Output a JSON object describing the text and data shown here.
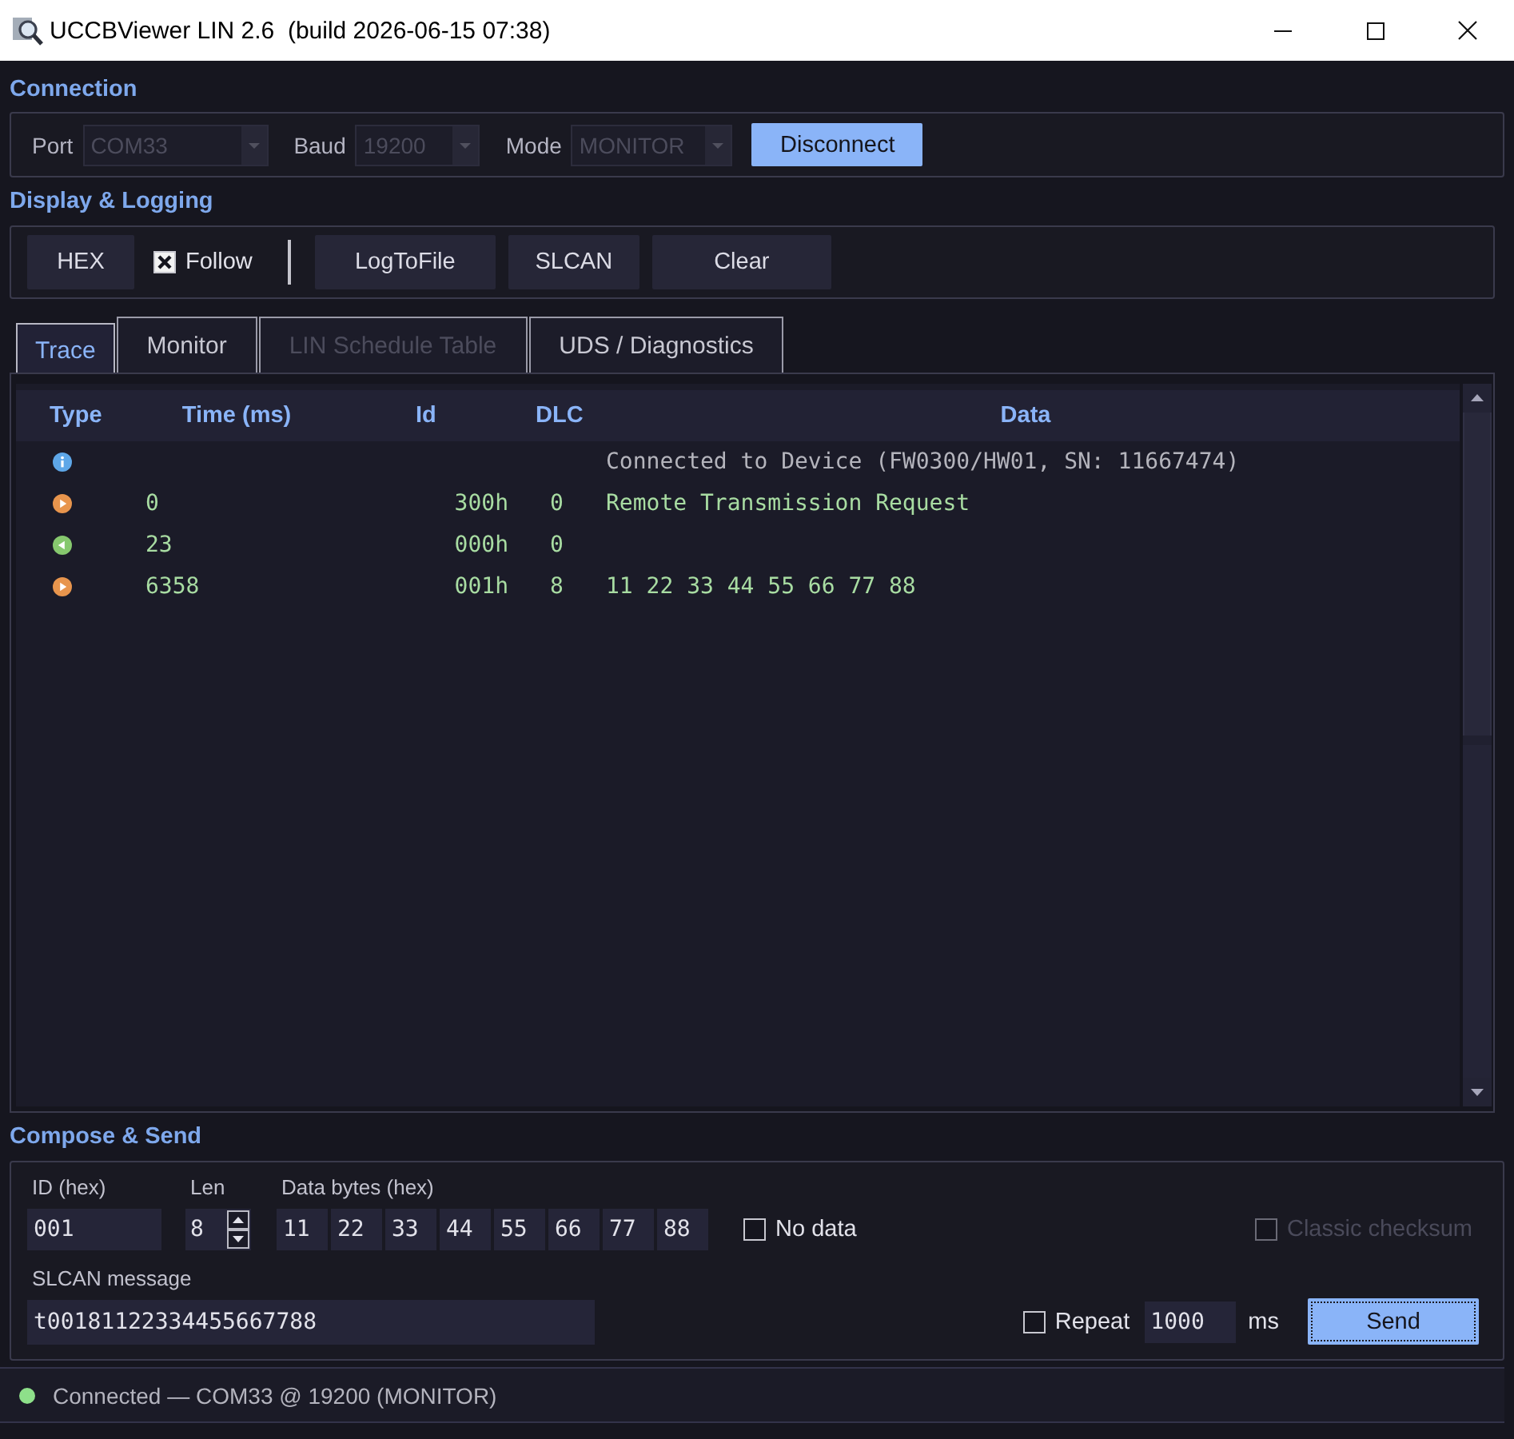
{
  "window": {
    "title": "UCCBViewer LIN 2.6  (build 2026-06-15 07:38)"
  },
  "connection": {
    "title": "Connection",
    "fields": [
      {
        "label": "Port",
        "value": "COM33",
        "disabled": true
      },
      {
        "label": "Baud",
        "value": "19200",
        "disabled": true
      },
      {
        "label": "Mode",
        "value": "MONITOR",
        "disabled": true
      }
    ],
    "button": {
      "label": "Disconnect",
      "primary": true
    }
  },
  "display": {
    "title": "Display & Logging",
    "items": [
      {
        "kind": "button",
        "label": "HEX"
      },
      {
        "kind": "checkbox",
        "label": "Follow",
        "checked": true
      },
      {
        "kind": "separator"
      },
      {
        "kind": "button",
        "label": "LogToFile"
      },
      {
        "kind": "button",
        "label": "SLCAN"
      },
      {
        "kind": "button",
        "label": "Clear"
      }
    ]
  },
  "tabs": [
    {
      "label": "Trace",
      "selected": true,
      "disabled": false
    },
    {
      "label": "Monitor",
      "selected": false,
      "disabled": false
    },
    {
      "label": "LIN Schedule Table",
      "selected": false,
      "disabled": true
    },
    {
      "label": "UDS / Diagnostics",
      "selected": false,
      "disabled": false
    }
  ],
  "trace": {
    "columns": [
      "Type",
      "Time (ms)",
      "Id",
      "DLC",
      "Data"
    ],
    "rows": [
      {
        "kind": "info",
        "data": "Connected to Device (FW0300/HW01, SN: 11667474)"
      },
      {
        "kind": "tx",
        "time": "0",
        "id": "300h",
        "dlc": "0",
        "data": "Remote Transmission Request"
      },
      {
        "kind": "rx",
        "time": "23",
        "id": "000h",
        "dlc": "0"
      },
      {
        "kind": "tx",
        "time": "6358",
        "id": "001h",
        "dlc": "8",
        "data": "11 22 33 44 55 66 77 88"
      }
    ]
  },
  "compose": {
    "title": "Compose & Send",
    "id": {
      "label": "ID (hex)",
      "value": "001"
    },
    "len": {
      "label": "Len",
      "value": "8"
    },
    "data_bytes": {
      "label": "Data bytes (hex)",
      "values": [
        "11",
        "22",
        "33",
        "44",
        "55",
        "66",
        "77",
        "88"
      ]
    },
    "no_data": {
      "label": "No data",
      "checked": false
    },
    "classic_checksum": {
      "label": "Classic checksum",
      "checked": false,
      "disabled": true
    },
    "slcan": {
      "label": "SLCAN message",
      "value": "t00181122334455667788"
    },
    "repeat": {
      "label": "Repeat",
      "checked": false
    },
    "interval": {
      "value": "1000",
      "unit": "ms"
    },
    "send": {
      "label": "Send",
      "primary": true,
      "focused": true
    }
  },
  "status": {
    "connected": true,
    "text": "Connected — COM33 @ 19200 (MONITOR)"
  }
}
